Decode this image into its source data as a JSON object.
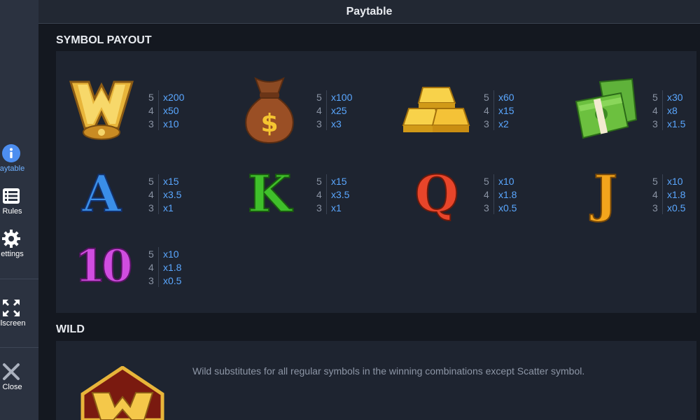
{
  "header": {
    "title": "Paytable"
  },
  "sidebar": {
    "items": [
      {
        "label": "aytable",
        "icon": "info-icon"
      },
      {
        "label": "Rules",
        "icon": "list-icon"
      },
      {
        "label": "ettings",
        "icon": "gear-icon"
      },
      {
        "label": "llscreen",
        "icon": "fullscreen-icon"
      },
      {
        "label": "Close",
        "icon": "close-icon"
      }
    ]
  },
  "symbol_payout": {
    "title": "SYMBOL PAYOUT",
    "symbols": [
      {
        "icon": "wild-w-icon",
        "pays": [
          {
            "count": "5",
            "mult": "x200"
          },
          {
            "count": "4",
            "mult": "x50"
          },
          {
            "count": "3",
            "mult": "x10"
          }
        ]
      },
      {
        "icon": "money-bag-icon",
        "pays": [
          {
            "count": "5",
            "mult": "x100"
          },
          {
            "count": "4",
            "mult": "x25"
          },
          {
            "count": "3",
            "mult": "x3"
          }
        ]
      },
      {
        "icon": "gold-bars-icon",
        "pays": [
          {
            "count": "5",
            "mult": "x60"
          },
          {
            "count": "4",
            "mult": "x15"
          },
          {
            "count": "3",
            "mult": "x2"
          }
        ]
      },
      {
        "icon": "cash-stack-icon",
        "pays": [
          {
            "count": "5",
            "mult": "x30"
          },
          {
            "count": "4",
            "mult": "x8"
          },
          {
            "count": "3",
            "mult": "x1.5"
          }
        ]
      },
      {
        "icon": "letter-a-icon",
        "glyph": "A",
        "color": "#3a8ee8",
        "pays": [
          {
            "count": "5",
            "mult": "x15"
          },
          {
            "count": "4",
            "mult": "x3.5"
          },
          {
            "count": "3",
            "mult": "x1"
          }
        ]
      },
      {
        "icon": "letter-k-icon",
        "glyph": "K",
        "color": "#3fbf2a",
        "pays": [
          {
            "count": "5",
            "mult": "x15"
          },
          {
            "count": "4",
            "mult": "x3.5"
          },
          {
            "count": "3",
            "mult": "x1"
          }
        ]
      },
      {
        "icon": "letter-q-icon",
        "glyph": "Q",
        "color": "#e8452a",
        "pays": [
          {
            "count": "5",
            "mult": "x10"
          },
          {
            "count": "4",
            "mult": "x1.8"
          },
          {
            "count": "3",
            "mult": "x0.5"
          }
        ]
      },
      {
        "icon": "letter-j-icon",
        "glyph": "J",
        "color": "#f3a51c",
        "pays": [
          {
            "count": "5",
            "mult": "x10"
          },
          {
            "count": "4",
            "mult": "x1.8"
          },
          {
            "count": "3",
            "mult": "x0.5"
          }
        ]
      },
      {
        "icon": "number-10-icon",
        "glyph": "10",
        "color": "#d04de0",
        "pays": [
          {
            "count": "5",
            "mult": "x10"
          },
          {
            "count": "4",
            "mult": "x1.8"
          },
          {
            "count": "3",
            "mult": "x0.5"
          }
        ]
      }
    ]
  },
  "wild": {
    "title": "WILD",
    "description": "Wild substitutes for all regular symbols in the winning combinations except Scatter symbol."
  }
}
